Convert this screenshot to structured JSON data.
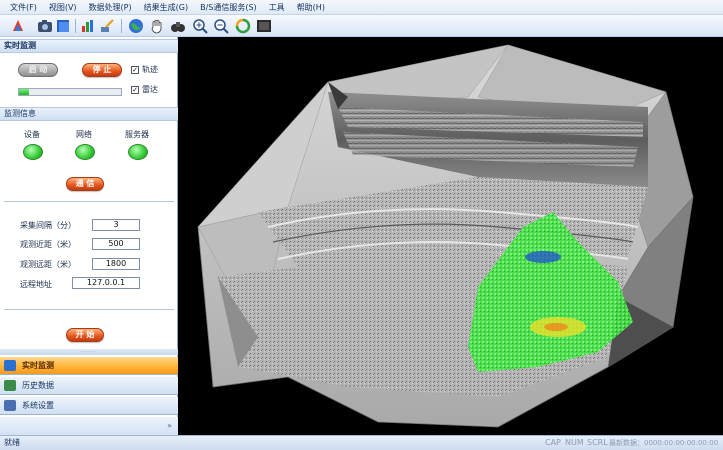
{
  "menu": [
    "文件(F)",
    "视图(V)",
    "数据处理(P)",
    "结果生成(G)",
    "B/S通信服务(S)",
    "工具",
    "帮助(H)"
  ],
  "toolbar": {
    "buttons": [
      "app-icon",
      "camera-icon",
      "layers-icon",
      "chart-icon",
      "tools-icon",
      "globe-icon",
      "pan-hand-icon",
      "binoculars-icon",
      "zoom-in-icon",
      "zoom-out-icon",
      "refresh-icon",
      "film-icon"
    ]
  },
  "realtime": {
    "title": "实时监测",
    "start_label": "启 动",
    "stop_label": "停 止",
    "trajectory_label": "轨迹",
    "trajectory_checked": "✓",
    "radar_label": "雷达",
    "radar_checked": "✓",
    "progress_value": 0.1
  },
  "monitor_info": {
    "title": "监测信息",
    "devices": [
      "设备",
      "网络",
      "服务器"
    ],
    "status_color": "#3bcf3b",
    "comm_label": "通 信"
  },
  "params": {
    "interval_label": "采集间隔（分）",
    "interval_value": "3",
    "near_label": "观测近距（米）",
    "near_value": "500",
    "far_label": "观测远距（米）",
    "far_value": "1800",
    "remote_label": "远程地址",
    "remote_value": "127.0.0.1",
    "begin_label": "开 始"
  },
  "nav": {
    "grip": "......",
    "items": [
      "实时监测",
      "历史数据",
      "系统设置"
    ],
    "active_index": 0,
    "footer": "»"
  },
  "status": {
    "left": "就绪",
    "indicators": [
      "CAP",
      "NUM",
      "SCRL",
      "最新数据：0000:00:00:00:00:00"
    ]
  }
}
